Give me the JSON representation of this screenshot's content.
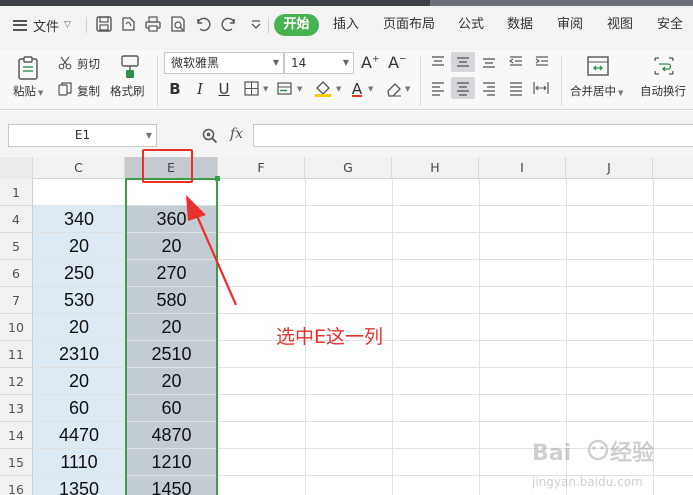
{
  "menubar": {
    "file_label": "文件",
    "tabs": [
      {
        "label": "开始",
        "active": true
      },
      {
        "label": "插入"
      },
      {
        "label": "页面布局"
      },
      {
        "label": "公式"
      },
      {
        "label": "数据"
      },
      {
        "label": "审阅"
      },
      {
        "label": "视图"
      },
      {
        "label": "安全"
      }
    ]
  },
  "ribbon": {
    "paste_label": "粘贴",
    "cut_label": "剪切",
    "copy_label": "复制",
    "format_painter_label": "格式刷",
    "font_name": "微软雅黑",
    "font_size": "14",
    "merge_center_label": "合并居中",
    "wrap_text_label": "自动换行"
  },
  "formula_bar": {
    "cell_ref": "E1",
    "fx_label": "fx",
    "formula": ""
  },
  "sheet": {
    "columns": [
      "C",
      "E",
      "F",
      "G",
      "H",
      "I",
      "J"
    ],
    "selected_column": "E",
    "rows": [
      {
        "row": "1",
        "c": "",
        "e": ""
      },
      {
        "row": "4",
        "c": "340",
        "e": "360"
      },
      {
        "row": "5",
        "c": "20",
        "e": "20"
      },
      {
        "row": "6",
        "c": "250",
        "e": "270"
      },
      {
        "row": "7",
        "c": "530",
        "e": "580"
      },
      {
        "row": "10",
        "c": "20",
        "e": "20"
      },
      {
        "row": "11",
        "c": "2310",
        "e": "2510"
      },
      {
        "row": "12",
        "c": "20",
        "e": "20"
      },
      {
        "row": "13",
        "c": "60",
        "e": "60"
      },
      {
        "row": "14",
        "c": "4470",
        "e": "4870"
      },
      {
        "row": "15",
        "c": "1110",
        "e": "1210"
      },
      {
        "row": "16",
        "c": "1350",
        "e": "1450"
      }
    ]
  },
  "annotation": {
    "text": "选中E这一列"
  },
  "watermark": {
    "brand": "Baidu 经验",
    "url": "jingyan.baidu.com"
  },
  "colors": {
    "accent_green": "#47b24f",
    "selection_border": "#3e9b48",
    "annotation_red": "#e8312b",
    "selected_fill": "#c3cbd3",
    "column_c_fill": "#ddeaf4"
  }
}
